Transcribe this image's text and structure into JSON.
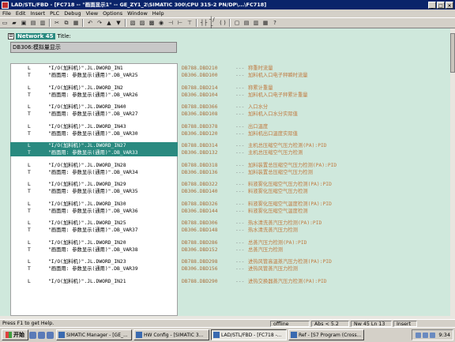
{
  "window": {
    "title": "LAD/STL/FBD - [FC718 -- \"画面显示1\" -- GE_ZY1_2\\SIMATIC 300\\CPU 315-2 PN/DP\\...\\FC718]",
    "buttons": [
      "_",
      "□",
      "×"
    ]
  },
  "menu": [
    "File",
    "Edit",
    "Insert",
    "PLC",
    "Debug",
    "View",
    "Options",
    "Window",
    "Help"
  ],
  "network": {
    "label": "Network 45",
    "title": "Title:",
    "comment": "DB306:模拟量显示"
  },
  "rows": [
    {
      "op1": "L",
      "a1": "\"I/O(加料机)\".JL.DWORD_IN1",
      "op2": "T",
      "a2": "\"画面用: 参数显示(通用)\".DB_VAR25",
      "r1": "DB788.DBD210",
      "c1": "称重时流量",
      "r2": "DB306.DBD100",
      "c2": "加料机入口电子秤瞬时流量",
      "sel": false
    },
    {
      "op1": "L",
      "a1": "\"I/O(加料机)\".JL.DWORD_IN2",
      "op2": "T",
      "a2": "\"画面用: 参数显示(通用)\".DB_VAR26",
      "r1": "DB788.DBD214",
      "c1": "称累计重量",
      "r2": "DB306.DBD104",
      "c2": "加料机入口电子秤累计重量",
      "sel": false
    },
    {
      "op1": "L",
      "a1": "\"I/O(加料机)\".JL.DWORD_IN40",
      "op2": "T",
      "a2": "\"画面用: 参数显示(通用)\".DB_VAR27",
      "r1": "DB788.DBD366",
      "c1": "入口水分",
      "r2": "DB306.DBD108",
      "c2": "加料机入口水分实际值",
      "sel": false
    },
    {
      "op1": "L",
      "a1": "\"I/O(加料机)\".JL.DWORD_IN43",
      "op2": "T",
      "a2": "\"画面用: 参数显示(通用)\".DB_VAR30",
      "r1": "DB788.DBD378",
      "c1": "出口温度",
      "r2": "DB306.DBD120",
      "c2": "加料机出口温度实际值",
      "sel": false
    },
    {
      "op1": "L",
      "a1": "\"I/O(加料机)\".JL.DWORD_IN27",
      "op2": "T",
      "a2": "\"画面用: 参数显示(通用)\".DB_VAR33",
      "r1": "DB788.DBD314",
      "c1": "主机总压缩空气压力检测(PA):PID",
      "r2": "DB306.DBD132",
      "c2": "主机总压缩空气压力检测",
      "sel": true
    },
    {
      "op1": "L",
      "a1": "\"I/O(加料机)\".JL.DWORD_IN28",
      "op2": "T",
      "a2": "\"画面用: 参数显示(通用)\".DB_VAR34",
      "r1": "DB788.DBD318",
      "c1": "加料装置总压缩空气压力检测(PA):PID",
      "r2": "DB306.DBD136",
      "c2": "加料装置总压缩空气压力检测",
      "sel": false
    },
    {
      "op1": "L",
      "a1": "\"I/O(加料机)\".JL.DWORD_IN29",
      "op2": "T",
      "a2": "\"画面用: 参数显示(通用)\".DB_VAR35",
      "r1": "DB788.DBD322",
      "c1": "料液雾化压缩空气压力检测(PA):PID",
      "r2": "DB306.DBD140",
      "c2": "料液雾化压缩空气压力检测",
      "sel": false
    },
    {
      "op1": "L",
      "a1": "\"I/O(加料机)\".JL.DWORD_IN30",
      "op2": "T",
      "a2": "\"画面用: 参数显示(通用)\".DB_VAR36",
      "r1": "DB788.DBD326",
      "c1": "料液雾化压缩空气温度检测(PA):PID",
      "r2": "DB306.DBD144",
      "c2": "料液雾化压缩空气温度检测",
      "sel": false
    },
    {
      "op1": "L",
      "a1": "\"I/O(加料机)\".JL.DWORD_IN25",
      "op2": "T",
      "a2": "\"画面用: 参数显示(通用)\".DB_VAR37",
      "r1": "DB788.DBD306",
      "c1": "热水清洗蒸汽压力检测(PA):PID",
      "r2": "DB306.DBD148",
      "c2": "热水清洗蒸汽压力检测",
      "sel": false
    },
    {
      "op1": "L",
      "a1": "\"I/O(加料机)\".JL.DWORD_IN20",
      "op2": "T",
      "a2": "\"画面用: 参数显示(通用)\".DB_VAR38",
      "r1": "DB788.DBD286",
      "c1": "总蒸汽压力检测(PA):PID",
      "r2": "DB306.DBD152",
      "c2": "总蒸汽压力检测",
      "sel": false
    },
    {
      "op1": "L",
      "a1": "\"I/O(加料机)\".JL.DWORD_IN23",
      "op2": "T",
      "a2": "\"画面用: 参数显示(通用)\".DB_VAR39",
      "r1": "DB788.DBD298",
      "c1": "进热风管高温蒸汽压力检测(PA):PID",
      "r2": "DB306.DBD156",
      "c2": "进热风管蒸汽压力检测",
      "sel": false
    },
    {
      "op1": "L",
      "a1": "\"I/O(加料机)\".JL.DWORD_IN21",
      "op2": "",
      "a2": "",
      "r1": "DB788.DBD290",
      "c1": "进热交换器蒸汽压力检测(PA):PID",
      "r2": "",
      "c2": "",
      "sel": false
    }
  ],
  "status": {
    "help": "Press F1 to get Help.",
    "mode": "offline",
    "abs": "Abs < 5.2",
    "pos": "Nw 45 Ln 13",
    "insert": "Insert"
  },
  "taskbar": {
    "start": "开始",
    "tasks": [
      "SIMATIC Manager - [GE_...",
      "HW Config - [SIMATIC 3...",
      "LAD/STL/FBD - [FC718 -...",
      "Ref - [S7 Program (Cross..."
    ],
    "active": 2,
    "clock": "9:34"
  }
}
